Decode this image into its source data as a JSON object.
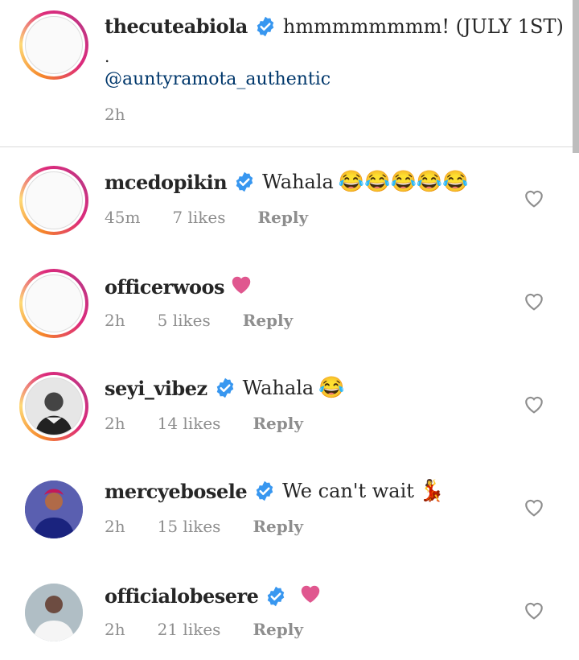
{
  "caption": {
    "username": "thecuteabiola",
    "text": "hmmmmmmmm! (JULY 1ST)",
    "dot": ".",
    "mention": "@auntyramota_authentic",
    "time": "2h"
  },
  "comments": [
    {
      "username": "mcedopikin",
      "verified": true,
      "text": "Wahala",
      "emoji": "😂😂😂😂😂",
      "time": "45m",
      "likes": "7 likes",
      "reply": "Reply"
    },
    {
      "username": "officerwoos",
      "verified": false,
      "text": "",
      "emoji": "💗",
      "time": "2h",
      "likes": "5 likes",
      "reply": "Reply"
    },
    {
      "username": "seyi_vibez",
      "verified": true,
      "text": "Wahala",
      "emoji": "😂",
      "time": "2h",
      "likes": "14 likes",
      "reply": "Reply"
    },
    {
      "username": "mercyebosele",
      "verified": true,
      "text": "We can't wait",
      "emoji": "💃",
      "time": "2h",
      "likes": "15 likes",
      "reply": "Reply"
    },
    {
      "username": "officialobesere",
      "verified": true,
      "text": "",
      "emoji": "💗",
      "time": "2h",
      "likes": "21 likes",
      "reply": "Reply"
    }
  ],
  "colors": {
    "verified_blue": "#3897f0",
    "heart_pink": "#e0578f",
    "meta_gray": "#8e8e8e",
    "mention_blue": "#00376b"
  }
}
